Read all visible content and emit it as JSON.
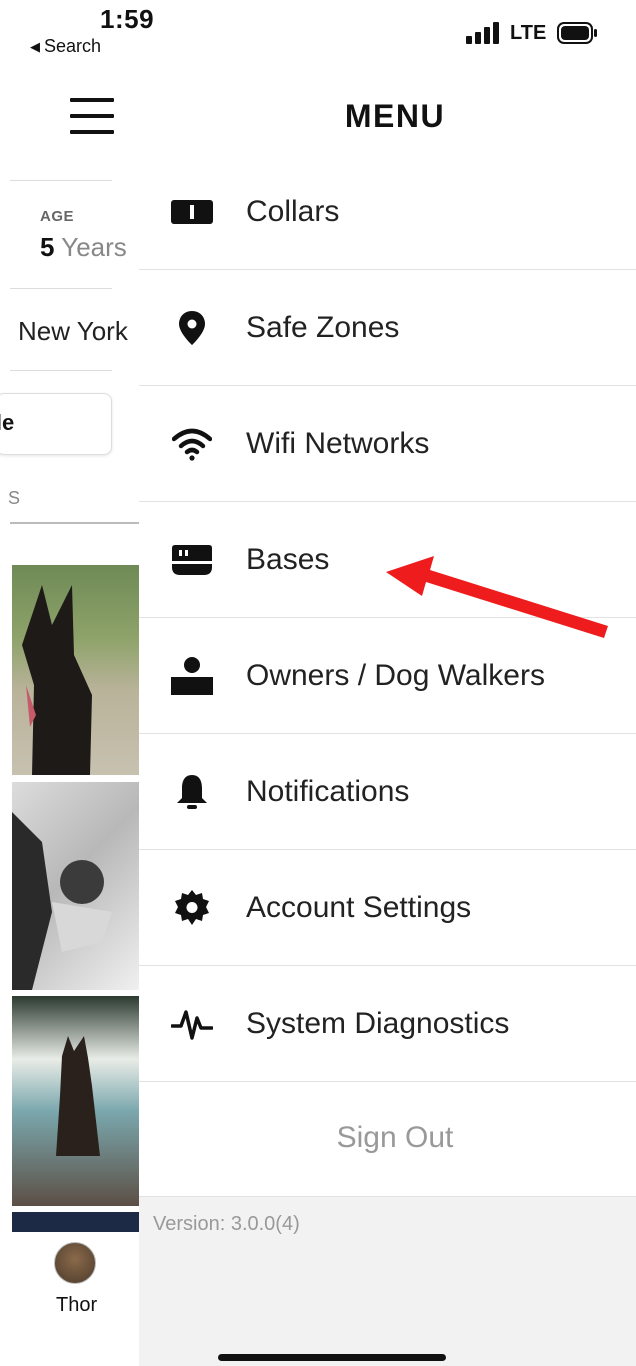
{
  "status_bar": {
    "time": "1:59",
    "back_label": "Search",
    "carrier": "LTE"
  },
  "background_app": {
    "age_label": "AGE",
    "age_number": "5",
    "age_unit": "Years",
    "city": "New York",
    "profile_button_fragment": "ofile",
    "section_fragment": "S",
    "pet_name": "Thor"
  },
  "drawer": {
    "title": "MENU",
    "items": [
      {
        "label": "Collars",
        "icon": "collar-icon"
      },
      {
        "label": "Safe Zones",
        "icon": "location-pin-icon"
      },
      {
        "label": "Wifi Networks",
        "icon": "wifi-icon"
      },
      {
        "label": "Bases",
        "icon": "base-station-icon"
      },
      {
        "label": "Owners / Dog Walkers",
        "icon": "person-icon"
      },
      {
        "label": "Notifications",
        "icon": "bell-icon"
      },
      {
        "label": "Account Settings",
        "icon": "gear-icon"
      },
      {
        "label": "System Diagnostics",
        "icon": "pulse-icon"
      }
    ],
    "sign_out": "Sign Out",
    "version": "Version: 3.0.0(4)"
  },
  "annotation": {
    "arrow_color": "#ee1c1c"
  }
}
